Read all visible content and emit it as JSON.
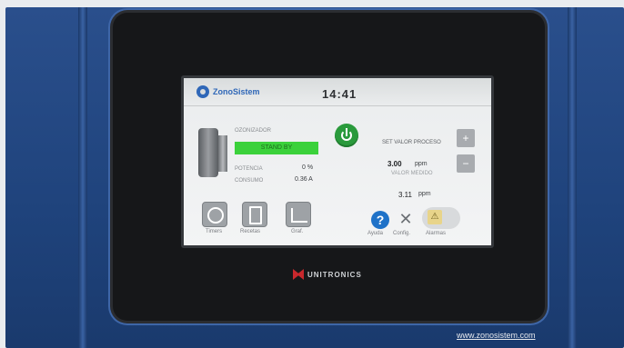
{
  "hmi": {
    "brand": "ZonoSistem",
    "time": "14:41",
    "device_label": "OZONIZADOR",
    "status": "STAND BY",
    "power_label": "POTENCIA",
    "power_value": "0 %",
    "consumption_label": "CONSUMO",
    "consumption_value": "0.36 A",
    "setpoint_label": "SET VALOR PROCESO",
    "setpoint_value": "3.00",
    "setpoint_unit": "ppm",
    "measured_label": "VALOR MEDIDO",
    "measured_value": "3.11",
    "measured_unit": "ppm",
    "plus": "+",
    "minus": "−",
    "nav": [
      {
        "label": "Timers"
      },
      {
        "label": "Recetas"
      },
      {
        "label": "Graf."
      }
    ],
    "help_label": "Ayuda",
    "config_label": "Config.",
    "alarm_label": "Alarmas",
    "icons": {
      "help": "question-icon",
      "tools": "tools-icon",
      "alarm": "warning-icon",
      "power": "power-icon"
    }
  },
  "cabinet": {
    "manufacturer": "UNITRONICS",
    "website": "www.zonosistem.com"
  },
  "colors": {
    "status_green": "#3bd13b",
    "power_green": "#2a9a3c",
    "help_blue": "#1f72c8",
    "cabinet_blue": "#2a4f8c"
  }
}
